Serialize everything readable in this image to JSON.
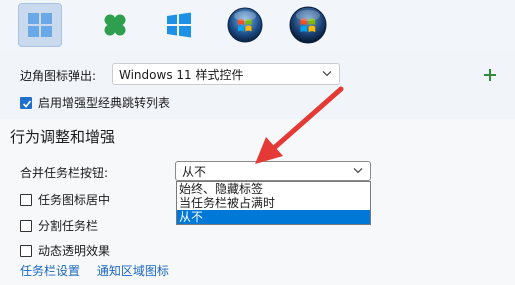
{
  "start_icons": [
    {
      "name": "windows11-tiles",
      "selected": true
    },
    {
      "name": "clover-four-leaf",
      "selected": false
    },
    {
      "name": "windows10-logo",
      "selected": false
    },
    {
      "name": "windows7-orb-small",
      "selected": false
    },
    {
      "name": "windows7-orb-large",
      "selected": false
    }
  ],
  "corner_icon": {
    "label": "边角图标弹出:",
    "value": "Windows 11 样式控件"
  },
  "add_label": "+",
  "enhanced_jump": {
    "label": "启用增强型经典跳转列表",
    "checked": true
  },
  "section": {
    "title": "行为调整和增强"
  },
  "merge_taskbar": {
    "label": "合并任务栏按钮:",
    "value": "从不",
    "options": [
      "始终、隐藏标签",
      "当任务栏被占满时",
      "从不"
    ],
    "selected_index": 2
  },
  "checkboxes": [
    {
      "label": "任务图标居中",
      "checked": false
    },
    {
      "label": "分割任务栏",
      "checked": false
    },
    {
      "label": "动态透明效果",
      "checked": false
    }
  ],
  "links": [
    "任务栏设置",
    "通知区域图标"
  ],
  "colors": {
    "accent": "#0078d7",
    "link": "#1a66c2",
    "arrow": "#e53935",
    "plus": "#2e8b3e"
  }
}
